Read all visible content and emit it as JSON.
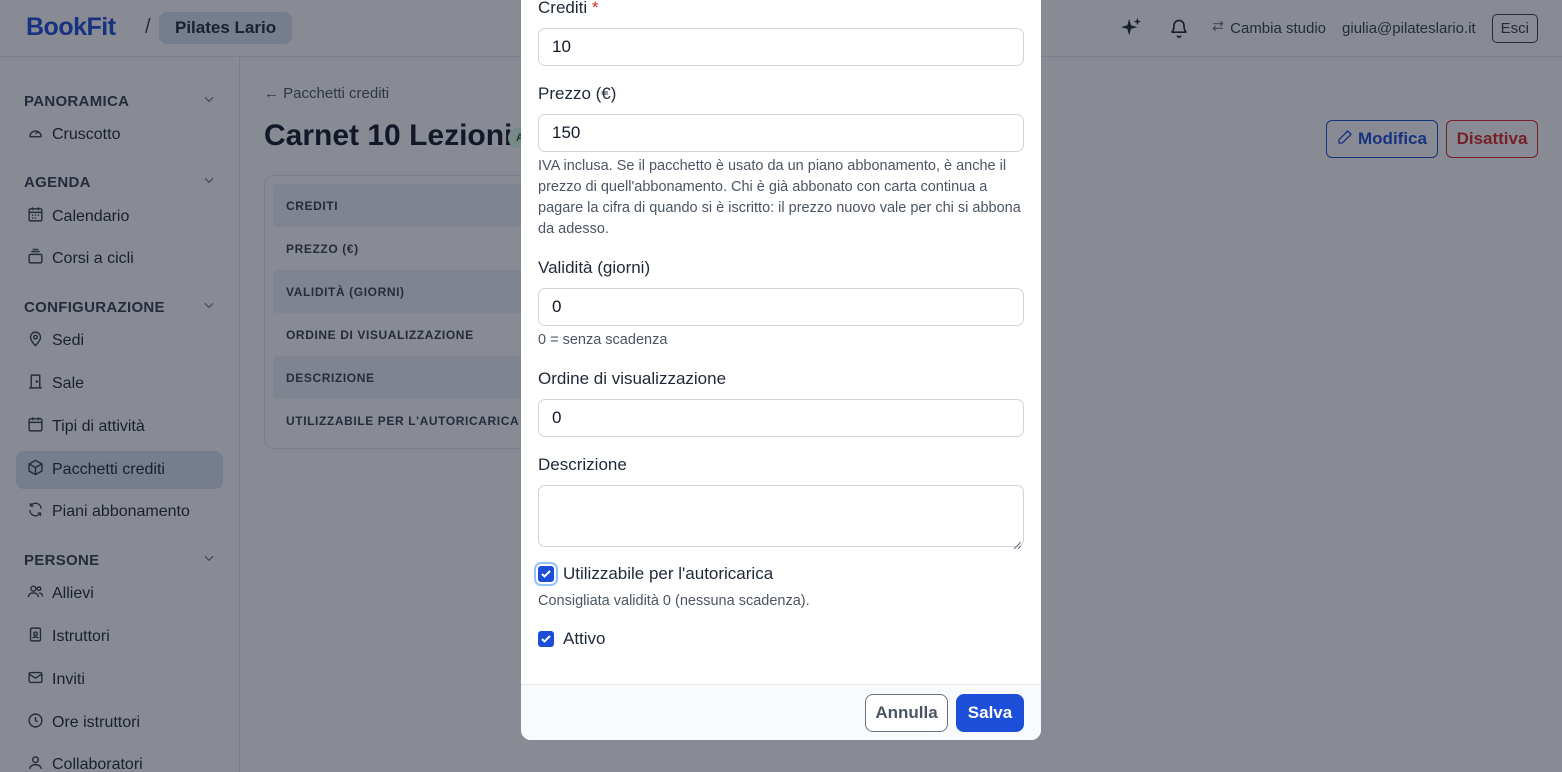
{
  "header": {
    "brand": "BookFit",
    "separator": "/",
    "studio": "Pilates Lario",
    "switch_label": "Cambia studio",
    "user_email": "giulia@pilateslario.it",
    "logout_label": "Esci"
  },
  "sidebar": {
    "sections": [
      {
        "title": "PANORAMICA",
        "items": [
          {
            "label": "Cruscotto",
            "icon": "gauge-icon"
          }
        ]
      },
      {
        "title": "AGENDA",
        "items": [
          {
            "label": "Calendario",
            "icon": "calendar-icon"
          },
          {
            "label": "Corsi a cicli",
            "icon": "layers-icon"
          }
        ]
      },
      {
        "title": "CONFIGURAZIONE",
        "items": [
          {
            "label": "Sedi",
            "icon": "map-pin-icon"
          },
          {
            "label": "Sale",
            "icon": "door-icon"
          },
          {
            "label": "Tipi di attività",
            "icon": "calendar-icon"
          },
          {
            "label": "Pacchetti crediti",
            "icon": "package-icon",
            "active": true
          },
          {
            "label": "Piani abbonamento",
            "icon": "refresh-icon"
          }
        ]
      },
      {
        "title": "PERSONE",
        "items": [
          {
            "label": "Allievi",
            "icon": "users-icon"
          },
          {
            "label": "Istruttori",
            "icon": "id-badge-icon"
          },
          {
            "label": "Inviti",
            "icon": "mail-icon"
          },
          {
            "label": "Ore istruttori",
            "icon": "clock-icon"
          },
          {
            "label": "Collaboratori",
            "icon": "user-icon"
          }
        ]
      }
    ]
  },
  "main": {
    "back_link": "← Pacchetti crediti",
    "title": "Carnet 10 Lezioni",
    "status_badge": "Attivo",
    "edit_label": "Modifica",
    "deactivate_label": "Disattiva",
    "rows": [
      "CREDITI",
      "PREZZO (€)",
      "VALIDITÀ (GIORNI)",
      "ORDINE DI VISUALIZZAZIONE",
      "DESCRIZIONE",
      "UTILIZZABILE PER L'AUTORICARICA"
    ]
  },
  "modal": {
    "credits_label": "Crediti",
    "credits_required": "*",
    "credits_value": "10",
    "price_label": "Prezzo (€)",
    "price_value": "150",
    "price_help": "IVA inclusa. Se il pacchetto è usato da un piano abbonamento, è anche il prezzo di quell'abbonamento. Chi è già abbonato con carta continua a pagare la cifra di quando si è iscritto: il prezzo nuovo vale per chi si abbona da adesso.",
    "validity_label": "Validità (giorni)",
    "validity_value": "0",
    "validity_help": "0 = senza scadenza",
    "order_label": "Ordine di visualizzazione",
    "order_value": "0",
    "description_label": "Descrizione",
    "description_value": "",
    "autorecharge_label": "Utilizzabile per l'autoricarica",
    "autorecharge_checked": true,
    "autorecharge_help": "Consigliata validità 0 (nessuna scadenza).",
    "active_label": "Attivo",
    "active_checked": true,
    "cancel_label": "Annulla",
    "save_label": "Salva"
  },
  "colors": {
    "brand": "#1d4ed8",
    "danger": "#dc2626",
    "active_nav": "#dbe3f4",
    "overlay": "rgba(17,24,39,0.5)"
  }
}
